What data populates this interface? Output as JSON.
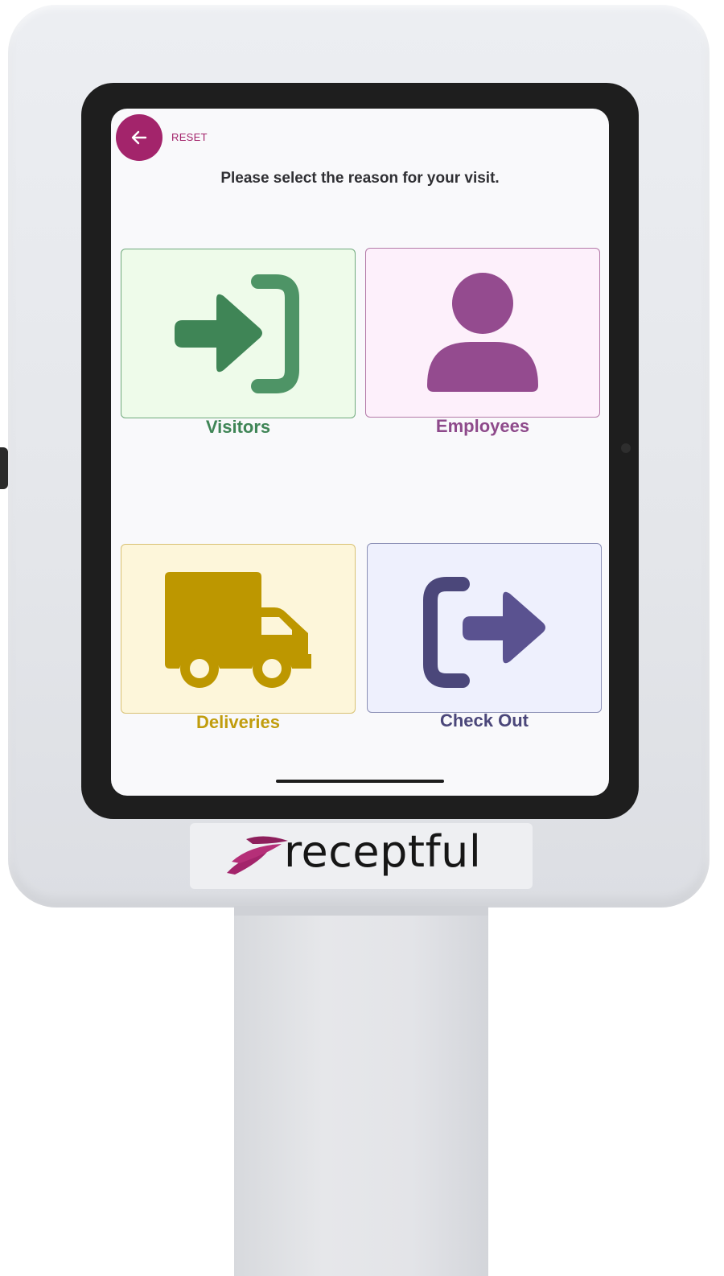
{
  "header": {
    "reset_label": "RESET"
  },
  "prompt": "Please select the reason for your visit.",
  "options": [
    {
      "label": "Visitors",
      "icon": "sign-in-icon",
      "color": "#3f8556"
    },
    {
      "label": "Employees",
      "icon": "user-icon",
      "color": "#8e4a8b"
    },
    {
      "label": "Deliveries",
      "icon": "truck-icon",
      "color": "#c19d0e"
    },
    {
      "label": "Check Out",
      "icon": "sign-out-icon",
      "color": "#4b477a"
    }
  ],
  "branding": {
    "logo_text": "receptful",
    "accent_color": "#a3246b"
  }
}
